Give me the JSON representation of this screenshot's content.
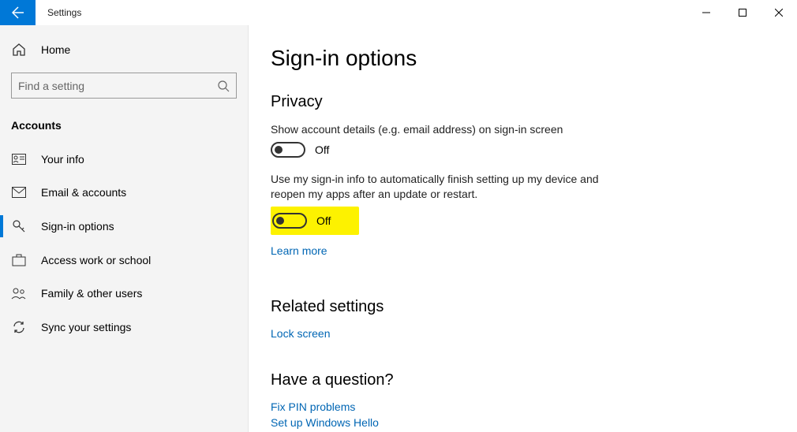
{
  "app_title": "Settings",
  "home_label": "Home",
  "search_placeholder": "Find a setting",
  "category": "Accounts",
  "nav": [
    {
      "label": "Your info"
    },
    {
      "label": "Email & accounts"
    },
    {
      "label": "Sign-in options"
    },
    {
      "label": "Access work or school"
    },
    {
      "label": "Family & other users"
    },
    {
      "label": "Sync your settings"
    }
  ],
  "page_title": "Sign-in options",
  "privacy": {
    "heading": "Privacy",
    "opt1_text": "Show account details (e.g. email address) on sign-in screen",
    "opt1_state": "Off",
    "opt2_text": "Use my sign-in info to automatically finish setting up my device and reopen my apps after an update or restart.",
    "opt2_state": "Off",
    "learn_more": "Learn more"
  },
  "related": {
    "heading": "Related settings",
    "lock_screen": "Lock screen"
  },
  "question": {
    "heading": "Have a question?",
    "fix_pin": "Fix PIN problems",
    "windows_hello": "Set up Windows Hello"
  }
}
